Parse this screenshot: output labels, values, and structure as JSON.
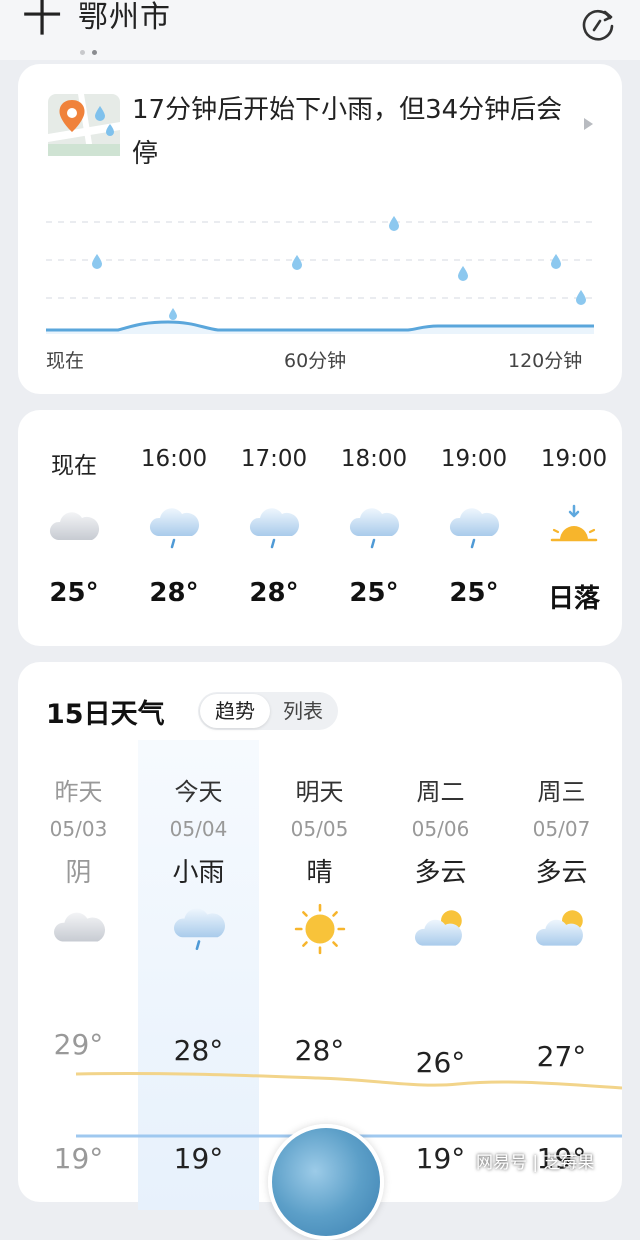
{
  "header": {
    "add_symbol": "十",
    "city": "鄂州市"
  },
  "rain_card": {
    "alert": "17分钟后开始下小雨，但34分钟后会停",
    "axis_labels": [
      "现在",
      "60分钟",
      "120分钟"
    ]
  },
  "hourly": [
    {
      "time": "现在",
      "icon": "cloudy-icon",
      "temp": "25°"
    },
    {
      "time": "16:00",
      "icon": "light-rain-icon",
      "temp": "28°"
    },
    {
      "time": "17:00",
      "icon": "light-rain-icon",
      "temp": "28°"
    },
    {
      "time": "18:00",
      "icon": "light-rain-icon",
      "temp": "25°"
    },
    {
      "time": "19:00",
      "icon": "light-rain-icon",
      "temp": "25°"
    },
    {
      "time": "19:00",
      "icon": "sunset-icon",
      "temp": "日落"
    }
  ],
  "daily": {
    "title": "15日天气",
    "toggle": {
      "trend": "趋势",
      "list": "列表"
    },
    "days": [
      {
        "day": "昨天",
        "date": "05/03",
        "condition": "阴",
        "icon": "cloudy-icon",
        "high": "29°",
        "low": "19°"
      },
      {
        "day": "今天",
        "date": "05/04",
        "condition": "小雨",
        "icon": "light-rain-icon",
        "high": "28°",
        "low": "19°"
      },
      {
        "day": "明天",
        "date": "05/05",
        "condition": "晴",
        "icon": "sunny-icon",
        "high": "28°",
        "low": ""
      },
      {
        "day": "周二",
        "date": "05/06",
        "condition": "多云",
        "icon": "partly-cloudy-icon",
        "high": "26°",
        "low": "19°"
      },
      {
        "day": "周三",
        "date": "05/07",
        "condition": "多云",
        "icon": "partly-cloudy-icon",
        "high": "27°",
        "low": "19°"
      }
    ]
  },
  "watermark": "网易号 | 芝莓果",
  "colors": {
    "rain": "#5aa6db",
    "high_line": "#f2d48a",
    "low_line": "#9fc8ef",
    "today_highlight": "#e7f1fc"
  }
}
